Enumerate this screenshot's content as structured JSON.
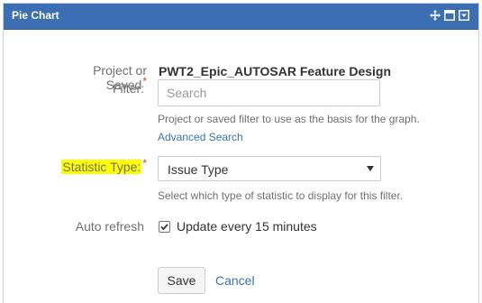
{
  "gadget": {
    "title": "Pie Chart",
    "title_bar_color": "#3c6eb4",
    "icons": [
      "move-icon",
      "maximize-icon",
      "dropdown-menu-icon"
    ]
  },
  "filter": {
    "label_line1": "Project or Saved",
    "label_line2": "Filter:",
    "required_mark": "*",
    "selected_name": "PWT2_Epic_AUTOSAR Feature Design",
    "search_placeholder": "Search",
    "help_text": "Project or saved filter to use as the basis for the graph.",
    "advanced_search_link": "Advanced Search"
  },
  "statistic": {
    "label": "Statistic Type:",
    "required_mark": "*",
    "selected_value": "Issue Type",
    "help_text": "Select which type of statistic to display for this filter.",
    "highlight_color": "#ffff00"
  },
  "refresh": {
    "label": "Auto refresh",
    "checkbox_label": "Update every 15 minutes",
    "checked": true
  },
  "actions": {
    "save_label": "Save",
    "cancel_label": "Cancel"
  }
}
